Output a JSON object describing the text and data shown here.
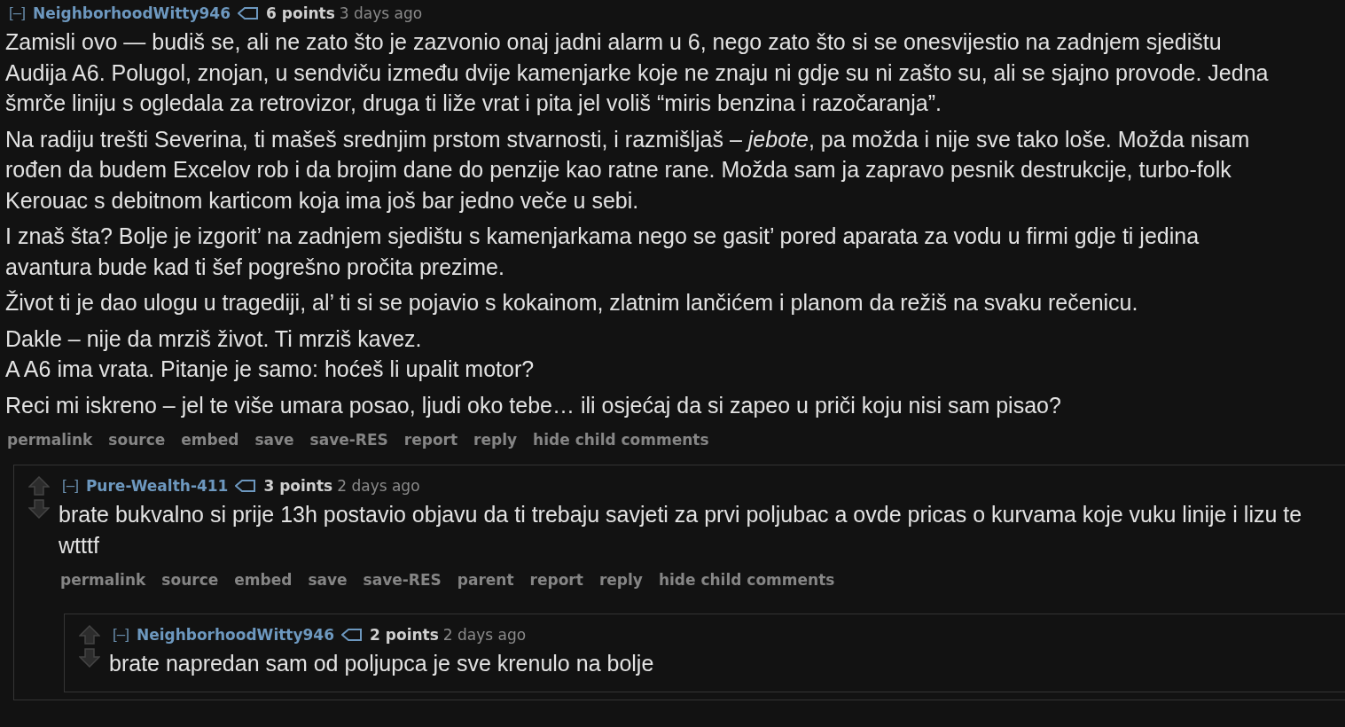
{
  "comments": [
    {
      "collapse": "[–]",
      "author": "NeighborhoodWitty946",
      "points": "6 points",
      "age": "3 days ago",
      "arrows": false,
      "paragraphs": [
        [
          "Zamisli ovo — budiš se, ali ne zato što je zazvonio onaj jadni alarm u 6, nego zato što si se onesvijestio na zadnjem sjedištu Audija A6. Polugol, znojan, u sendviču između dvije kamenjarke koje ne znaju ni gdje su ni zašto su, ali se sjajno provode. Jedna šmrče liniju s ogledala za retrovizor, druga ti liže vrat i pita jel voliš “miris benzina i razočaranja”."
        ],
        [
          "Na radiju trešti Severina, ti mašeš srednjim prstom stvarnosti, i razmišljaš – *jebote*, pa možda i nije sve tako loše. Možda nisam rođen da budem Excelov rob i da brojim dane do penzije kao ratne rane. Možda sam ja zapravo pesnik destrukcije, turbo-folk Kerouac s debitnom karticom koja ima još bar jedno veče u sebi."
        ],
        [
          "I znaš šta? Bolje je izgorit’ na zadnjem sjedištu s kamenjarkama nego se gasit’ pored aparata za vodu u firmi gdje ti jedina avantura bude kad ti šef pogrešno pročita prezime."
        ],
        [
          "Život ti je dao ulogu u tragediji, al’ ti si se pojavio s kokainom, zlatnim lančićem i planom da režiš na svaku rečenicu."
        ],
        [
          "Dakle – nije da mrziš život. Ti mrziš kavez.",
          "A A6 ima vrata. Pitanje je samo: hoćeš li upalit motor?"
        ],
        [
          "Reci mi iskreno – jel te više umara posao, ljudi oko tebe… ili osjećaj da si zapeo u priči koju nisi sam pisao?"
        ]
      ],
      "actions": [
        "permalink",
        "source",
        "embed",
        "save",
        "save-RES",
        "report",
        "reply",
        "hide child comments"
      ],
      "children": [
        {
          "collapse": "[–]",
          "author": "Pure-Wealth-411",
          "points": "3 points",
          "age": "2 days ago",
          "arrows": true,
          "paragraphs": [
            [
              "brate bukvalno si prije 13h postavio objavu da ti trebaju savjeti za prvi poljubac a ovde pricas o kurvama koje vuku linije i lizu te wtttf"
            ]
          ],
          "actions": [
            "permalink",
            "source",
            "embed",
            "save",
            "save-RES",
            "parent",
            "report",
            "reply",
            "hide child comments"
          ],
          "children": [
            {
              "collapse": "[–]",
              "author": "NeighborhoodWitty946",
              "points": "2 points",
              "age": "2 days ago",
              "arrows": true,
              "paragraphs": [
                [
                  "brate napredan sam od poljupca je sve krenulo na bolje"
                ]
              ]
            }
          ]
        }
      ]
    }
  ]
}
